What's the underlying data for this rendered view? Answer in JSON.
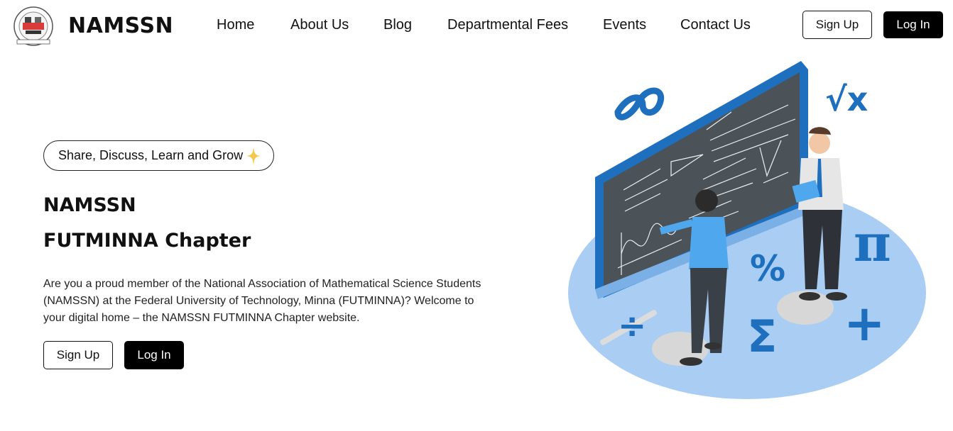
{
  "brand": {
    "name": "NAMSSN"
  },
  "nav": {
    "links": [
      "Home",
      "About Us",
      "Blog",
      "Departmental Fees",
      "Events",
      "Contact Us"
    ],
    "signup_label": "Sign Up",
    "login_label": "Log In"
  },
  "hero": {
    "tagline": "Share, Discuss, Learn and Grow",
    "title_line1": "NAMSSN",
    "title_line2": "FUTMINNA Chapter",
    "description": "Are you a proud member of the National Association of Mathematical Science Students (NAMSSN) at the Federal University of Technology, Minna (FUTMINNA)? Welcome to your digital home – the NAMSSN FUTMINNA Chapter website.",
    "signup_label": "Sign Up",
    "login_label": "Log In"
  },
  "illustration": {
    "board_formulas": [
      "a²+b²=c²",
      "A=½ab sinc=A²B²c²",
      "a²+b²=c²",
      "√3/4=(a²)",
      "1+B=0=>B=½",
      "a²+b²=c²",
      "27/32=0.8457",
      "√(x²+y²)=10",
      "tanα",
      "∞",
      "√x",
      "%",
      "Σ",
      "π",
      "÷",
      "+"
    ]
  },
  "colors": {
    "accent_blue": "#1f6fbf",
    "light_blue": "#a9cdf3",
    "board": "#4b5358",
    "button_dark": "#000000"
  }
}
